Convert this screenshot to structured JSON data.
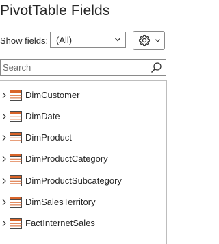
{
  "title": "PivotTable Fields",
  "show_fields": {
    "label": "Show fields:",
    "value": "(All)"
  },
  "settings": {
    "icon": "gear-icon",
    "menu_icon": "chevron-down-icon"
  },
  "search": {
    "placeholder": "Search",
    "icon": "search-icon"
  },
  "fields": [
    {
      "label": "DimCustomer",
      "icon": "table-icon"
    },
    {
      "label": "DimDate",
      "icon": "table-icon"
    },
    {
      "label": "DimProduct",
      "icon": "table-icon"
    },
    {
      "label": "DimProductCategory",
      "icon": "table-icon"
    },
    {
      "label": "DimProductSubcategory",
      "icon": "table-icon"
    },
    {
      "label": "DimSalesTerritory",
      "icon": "table-icon"
    },
    {
      "label": "FactInternetSales",
      "icon": "table-icon"
    }
  ],
  "colors": {
    "table_icon_orange": "#d9652a",
    "table_icon_border": "#4a4a4a"
  }
}
